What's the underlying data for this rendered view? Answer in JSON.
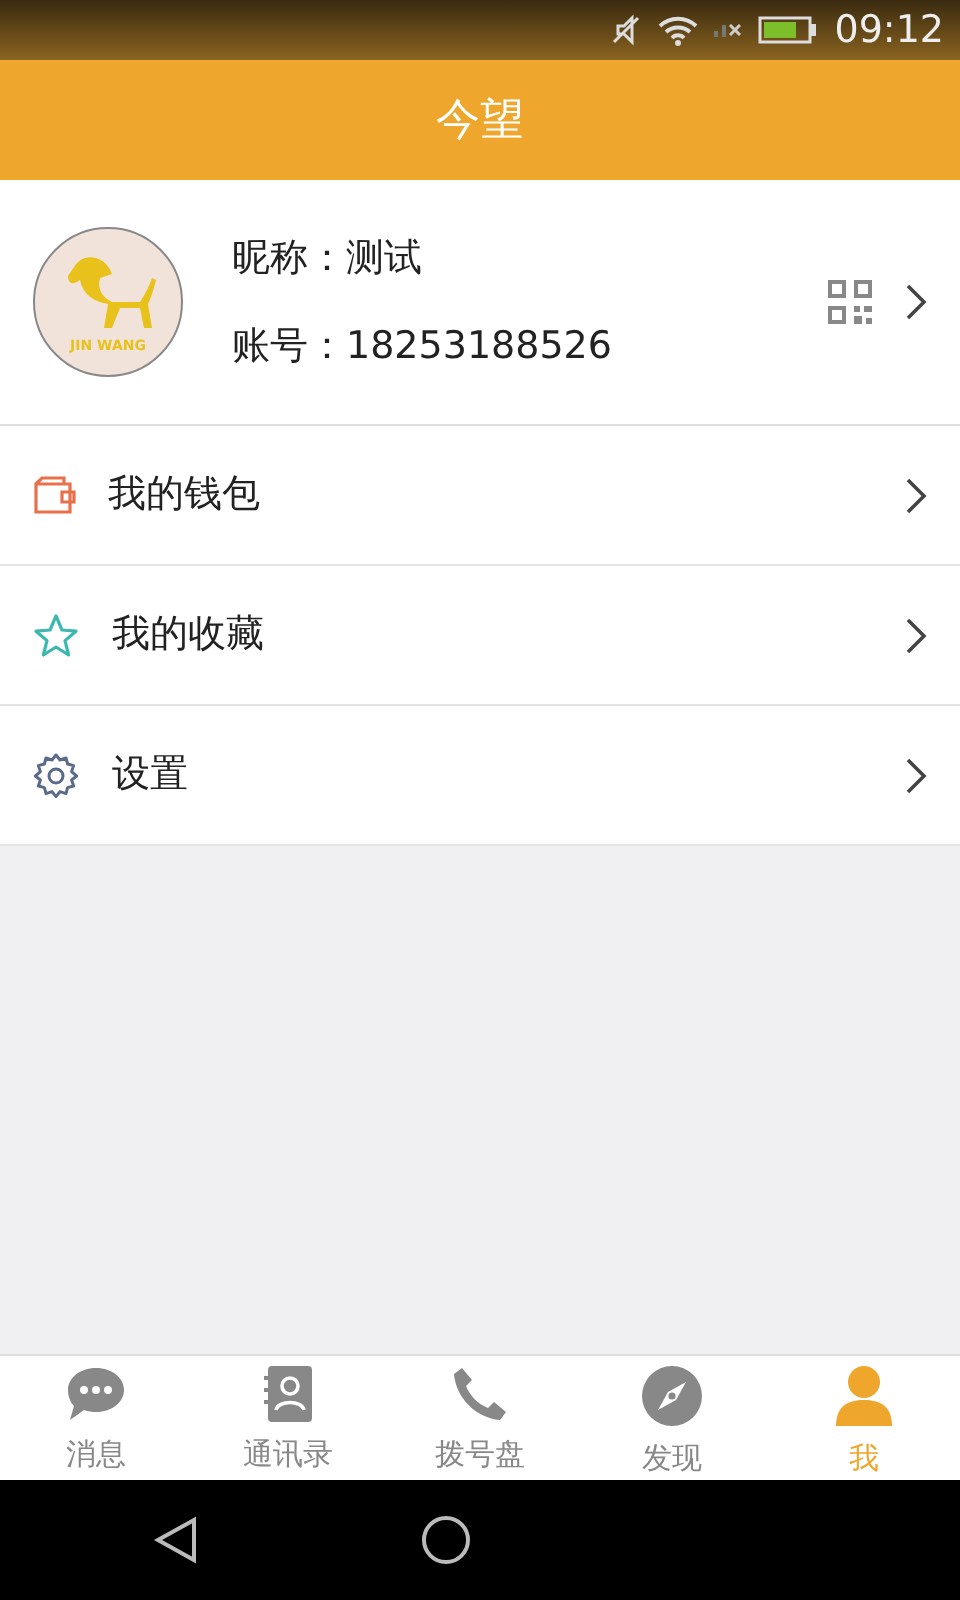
{
  "status_bar": {
    "time": "09:12"
  },
  "header": {
    "title": "今望"
  },
  "profile": {
    "logo_text": "JIN WANG",
    "nickname_label": "昵称：",
    "nickname": "测试",
    "account_label": "账号：",
    "account": "18253188526"
  },
  "menu": [
    {
      "kind": "wallet",
      "label": "我的钱包"
    },
    {
      "kind": "star",
      "label": "我的收藏"
    },
    {
      "kind": "gear",
      "label": "设置"
    }
  ],
  "tabs": [
    {
      "kind": "chat",
      "label": "消息",
      "selected": false
    },
    {
      "kind": "contacts",
      "label": "通讯录",
      "selected": false
    },
    {
      "kind": "phone",
      "label": "拨号盘",
      "selected": false
    },
    {
      "kind": "compass",
      "label": "发现",
      "selected": false
    },
    {
      "kind": "person",
      "label": "我",
      "selected": true
    }
  ]
}
